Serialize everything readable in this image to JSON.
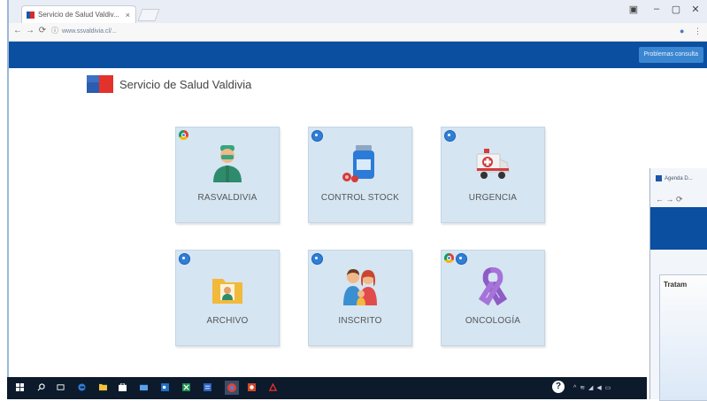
{
  "browser": {
    "tab_title": "Servicio de Salud Valdiv...",
    "tab_close": "×",
    "url": "www.ssvaldivia.cl/...",
    "window_controls": {
      "minimize": "–",
      "maximize": "▢",
      "close": "✕"
    },
    "nav": {
      "back": "←",
      "forward": "→",
      "reload": "⟳"
    },
    "icons": [
      "restore-icon",
      "minimize-icon",
      "maximize-icon",
      "close-icon",
      "back-icon",
      "forward-icon",
      "reload-icon",
      "info-icon",
      "extension-icon",
      "menu-icon"
    ]
  },
  "site": {
    "header_button": "Problemas consulta",
    "title": "Servicio de Salud Valdivia"
  },
  "tiles": [
    {
      "label": "RASVALDIVIA",
      "badge": "chrome",
      "icon": "doctor-icon"
    },
    {
      "label": "CONTROL STOCK",
      "badge": "blue",
      "icon": "medicine-bottle-icon"
    },
    {
      "label": "URGENCIA",
      "badge": "blue",
      "icon": "ambulance-icon"
    },
    {
      "label": "ARCHIVO",
      "badge": "blue",
      "icon": "folder-icon"
    },
    {
      "label": "INSCRITO",
      "badge": "blue",
      "icon": "family-icon"
    },
    {
      "label": "ONCOLOGÍA",
      "badge": "chrome+blue",
      "icon": "cancer-ribbon-icon"
    }
  ],
  "second_window": {
    "tab_title": "Agenda D...",
    "panel_title": "Tratam"
  },
  "taskbar": {
    "help": "?",
    "tray": "^ ≋ ◢ ◀ ▭"
  },
  "colors": {
    "header_blue": "#0a4fa0",
    "tile_bg": "#d5e5f2",
    "logo_blue": "#2a5db0",
    "logo_red": "#e3322b",
    "taskbar": "#0c1a2c"
  }
}
